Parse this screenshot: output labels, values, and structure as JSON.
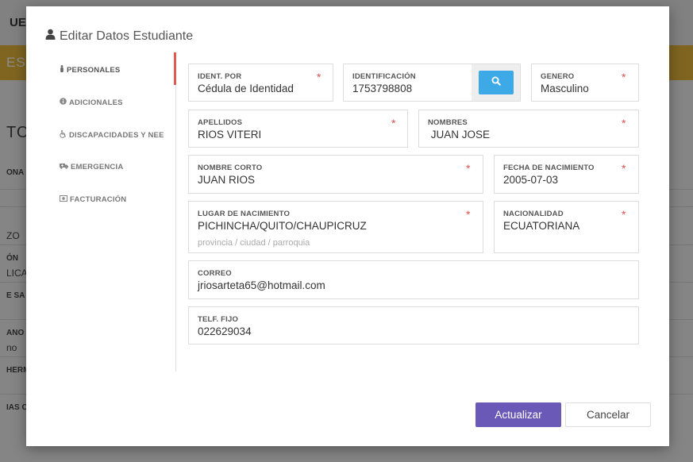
{
  "background": {
    "brand": "UE",
    "band_text": "ESTU",
    "title": "TOS",
    "rows": [
      "ONA",
      "ZO",
      "ÓN",
      "LICA",
      "E SA",
      "ANO",
      "no",
      "HERM",
      "IAS C"
    ]
  },
  "modal": {
    "title": "Editar Datos Estudiante",
    "tabs": [
      {
        "label": "PERSONALES",
        "icon": "person-icon"
      },
      {
        "label": "ADICIONALES",
        "icon": "info-icon"
      },
      {
        "label": "DISCAPACIDADES Y NEE",
        "icon": "wheelchair-icon"
      },
      {
        "label": "EMERGENCIA",
        "icon": "ambulance-icon"
      },
      {
        "label": "FACTURACIÓN",
        "icon": "money-icon"
      }
    ],
    "required_mark": "*",
    "fields": {
      "ident_por": {
        "label": "IDENT. POR",
        "value": "Cédula de Identidad"
      },
      "identificacion": {
        "label": "IDENTIFICACIÓN",
        "value": "1753798808"
      },
      "genero": {
        "label": "GENERO",
        "value": "Masculino"
      },
      "apellidos": {
        "label": "APELLIDOS",
        "value": "RIOS VITERI"
      },
      "nombres": {
        "label": "NOMBRES",
        "value": " JUAN JOSE"
      },
      "nombre_corto": {
        "label": "NOMBRE CORTO",
        "value": "JUAN RIOS"
      },
      "fecha_nacimiento": {
        "label": "FECHA DE NACIMIENTO",
        "value": "2005-07-03"
      },
      "lugar_nacimiento": {
        "label": "LUGAR DE NACIMIENTO",
        "value": "PICHINCHA/QUITO/CHAUPICRUZ",
        "hint": "provincia / ciudad / parroquia"
      },
      "nacionalidad": {
        "label": "NACIONALIDAD",
        "value": "ECUATORIANA"
      },
      "correo": {
        "label": "CORREO",
        "value": "jriosarteta65@hotmail.com"
      },
      "telf_fijo": {
        "label": "TELF. FIJO",
        "value": "022629034"
      }
    },
    "buttons": {
      "update": "Actualizar",
      "cancel": "Cancelar"
    }
  },
  "colors": {
    "accent": "#6a59b7",
    "search": "#3ea9e7",
    "required": "#e04f4f",
    "active_tab_bar": "#e05a4f",
    "band": "#e7b93b"
  }
}
